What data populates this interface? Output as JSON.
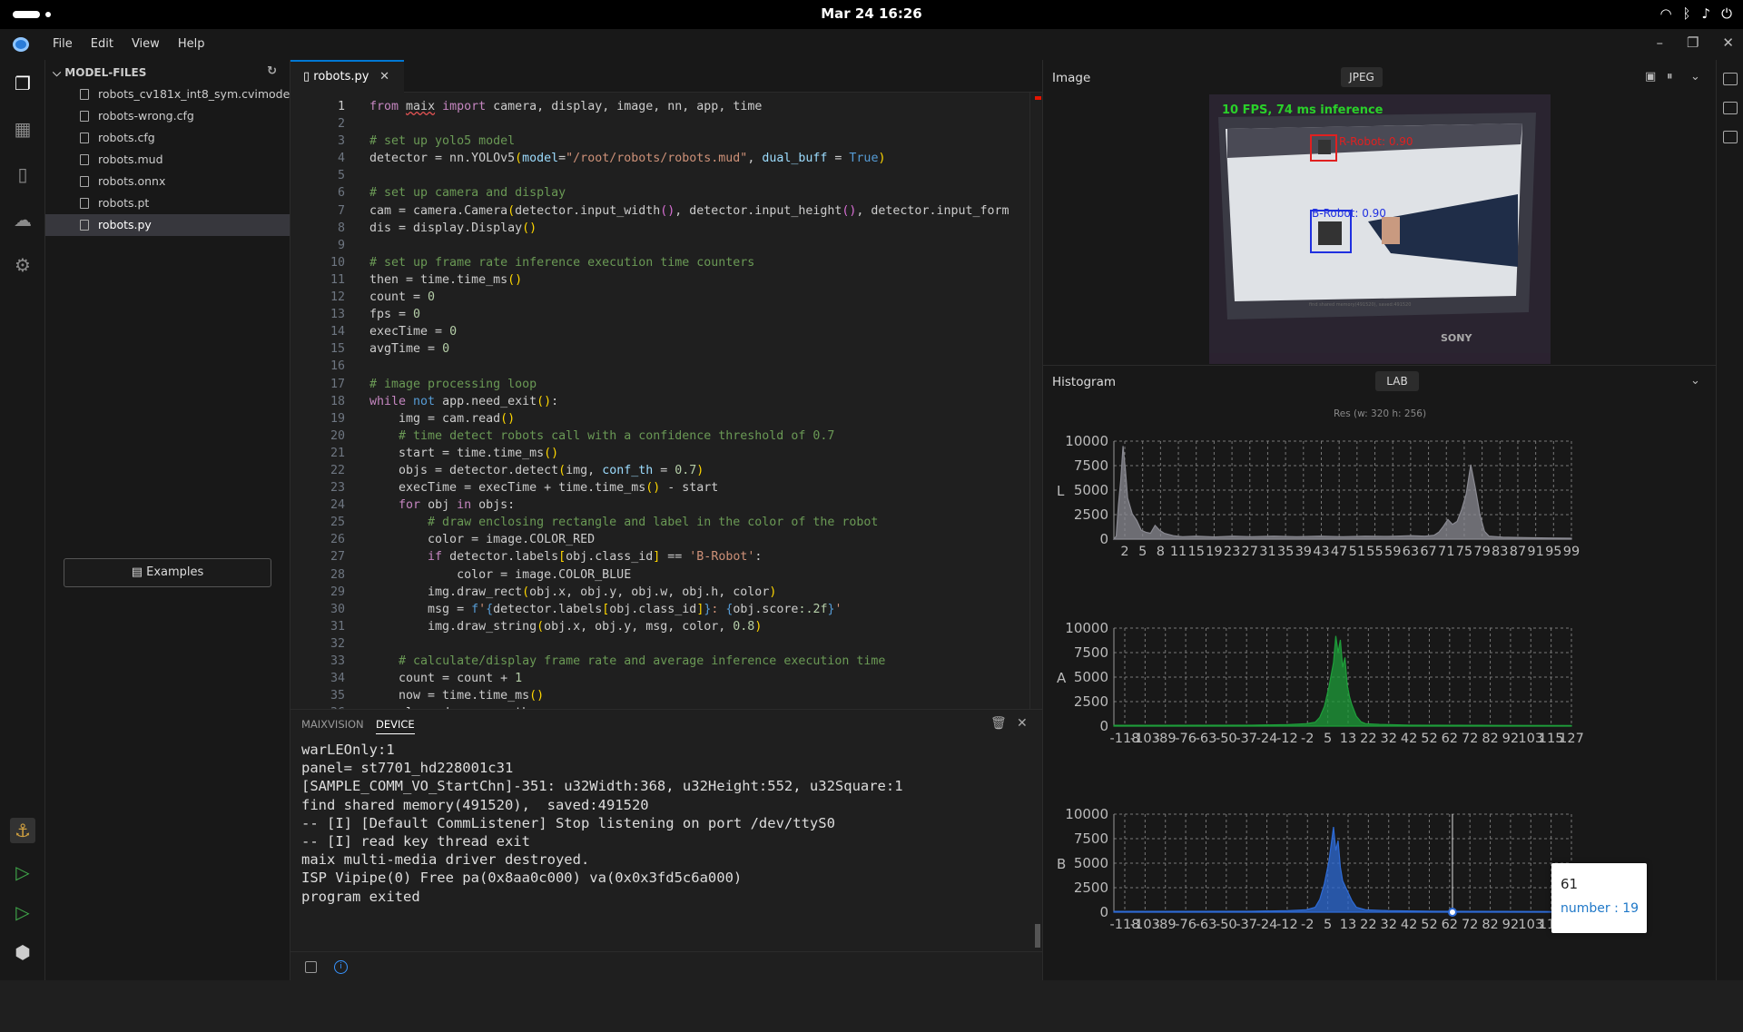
{
  "system": {
    "datetime": "Mar 24  16:26"
  },
  "menu": {
    "items": [
      "File",
      "Edit",
      "View",
      "Help"
    ]
  },
  "explorer": {
    "title": "MODEL-FILES",
    "files": [
      "robots_cv181x_int8_sym.cvimodel",
      "robots-wrong.cfg",
      "robots.cfg",
      "robots.mud",
      "robots.onnx",
      "robots.pt",
      "robots.py"
    ],
    "selected": "robots.py",
    "examples_label": "Examples"
  },
  "editor": {
    "tab_label": "robots.py",
    "current_line": 1
  },
  "terminal": {
    "tabs": [
      "MAIXVISION",
      "DEVICE"
    ],
    "active_tab": "DEVICE",
    "lines": [
      "warLEOnly:1",
      "panel= st7701_hd228001c31",
      "[SAMPLE_COMM_VO_StartChn]-351: u32Width:368, u32Height:552, u32Square:1",
      "find shared memory(491520),  saved:491520",
      "-- [I] [Default CommListener] Stop listening on port /dev/ttyS0",
      "-- [I] read key thread exit",
      "maix multi-media driver destroyed.",
      "ISP Vipipe(0) Free pa(0x8aa0c000) va(0x0x3fd5c6a000)",
      "",
      "program exited"
    ]
  },
  "image_panel": {
    "title": "Image",
    "format": "JPEG",
    "overlay": {
      "fps_text": "10 FPS, 74 ms inference",
      "label_red": "R-Robot: 0.90",
      "label_blue": "B-Robot: 0.90",
      "bottom_text": "find shared memory(491520), saved:491520",
      "brand": "SONY"
    }
  },
  "histogram_panel": {
    "title": "Histogram",
    "colorspace": "LAB",
    "resolution": "Res (w: 320 h: 256)"
  },
  "chart_data": [
    {
      "type": "area",
      "name": "L",
      "ylim": [
        0,
        10000
      ],
      "yticks": [
        0,
        2500,
        5000,
        7500,
        10000
      ],
      "xticks": [
        "2",
        "5",
        "8",
        "11",
        "15",
        "19",
        "23",
        "27",
        "31",
        "35",
        "39",
        "43",
        "47",
        "51",
        "55",
        "59",
        "63",
        "67",
        "71",
        "75",
        "79",
        "83",
        "87",
        "91",
        "95",
        "99"
      ],
      "xlim": [
        0,
        100
      ],
      "color": "#8a8a92",
      "points": [
        [
          0,
          0
        ],
        [
          0.5,
          300
        ],
        [
          1,
          3500
        ],
        [
          1.5,
          6000
        ],
        [
          2,
          9500
        ],
        [
          2.5,
          7200
        ],
        [
          3,
          4200
        ],
        [
          4,
          2600
        ],
        [
          5,
          1900
        ],
        [
          6,
          900
        ],
        [
          7,
          700
        ],
        [
          8,
          600
        ],
        [
          9,
          1400
        ],
        [
          10,
          900
        ],
        [
          11,
          600
        ],
        [
          13,
          350
        ],
        [
          15,
          250
        ],
        [
          18,
          300
        ],
        [
          22,
          220
        ],
        [
          26,
          300
        ],
        [
          30,
          250
        ],
        [
          35,
          300
        ],
        [
          40,
          250
        ],
        [
          45,
          300
        ],
        [
          50,
          250
        ],
        [
          55,
          300
        ],
        [
          60,
          280
        ],
        [
          65,
          350
        ],
        [
          68,
          300
        ],
        [
          70,
          400
        ],
        [
          71,
          700
        ],
        [
          72,
          1300
        ],
        [
          73,
          2000
        ],
        [
          74,
          1500
        ],
        [
          75,
          1800
        ],
        [
          76,
          3000
        ],
        [
          77,
          4600
        ],
        [
          78,
          7600
        ],
        [
          79,
          5200
        ],
        [
          80,
          2500
        ],
        [
          81,
          800
        ],
        [
          82,
          300
        ],
        [
          85,
          200
        ],
        [
          90,
          150
        ],
        [
          95,
          120
        ],
        [
          100,
          100
        ]
      ]
    },
    {
      "type": "area",
      "name": "A",
      "ylim": [
        0,
        10000
      ],
      "yticks": [
        0,
        2500,
        5000,
        7500,
        10000
      ],
      "xticks": [
        "-118",
        "-103",
        "-89",
        "-76",
        "-63",
        "-50",
        "-37",
        "-24",
        "-12",
        "-2",
        "5",
        "13",
        "22",
        "32",
        "42",
        "52",
        "62",
        "72",
        "82",
        "92",
        "103",
        "115",
        "127"
      ],
      "xlim": [
        0,
        100
      ],
      "color": "#1e9e3a",
      "points": [
        [
          0,
          80
        ],
        [
          30,
          100
        ],
        [
          38,
          150
        ],
        [
          42,
          250
        ],
        [
          44,
          400
        ],
        [
          45,
          900
        ],
        [
          46,
          2000
        ],
        [
          47,
          4000
        ],
        [
          48,
          6500
        ],
        [
          48.5,
          9200
        ],
        [
          49,
          7500
        ],
        [
          49.5,
          8800
        ],
        [
          50,
          6000
        ],
        [
          50.5,
          7000
        ],
        [
          51,
          4200
        ],
        [
          51.5,
          3000
        ],
        [
          52,
          2200
        ],
        [
          53,
          1000
        ],
        [
          54,
          450
        ],
        [
          55,
          250
        ],
        [
          58,
          180
        ],
        [
          65,
          100
        ],
        [
          80,
          80
        ],
        [
          100,
          60
        ]
      ]
    },
    {
      "type": "area",
      "name": "B",
      "ylim": [
        0,
        10000
      ],
      "yticks": [
        0,
        2500,
        5000,
        7500,
        10000
      ],
      "xticks": [
        "-118",
        "-103",
        "-89",
        "-76",
        "-63",
        "-50",
        "-37",
        "-24",
        "-12",
        "-2",
        "5",
        "13",
        "22",
        "32",
        "42",
        "52",
        "62",
        "72",
        "82",
        "92",
        "103",
        "115",
        "127"
      ],
      "xlim": [
        0,
        100
      ],
      "color": "#2e6bd6",
      "points": [
        [
          0,
          80
        ],
        [
          30,
          100
        ],
        [
          38,
          150
        ],
        [
          42,
          250
        ],
        [
          44,
          500
        ],
        [
          45,
          1300
        ],
        [
          46,
          2900
        ],
        [
          47,
          5200
        ],
        [
          48,
          8700
        ],
        [
          48.5,
          6300
        ],
        [
          49,
          7300
        ],
        [
          49.5,
          4600
        ],
        [
          50,
          3200
        ],
        [
          51,
          2200
        ],
        [
          52,
          1200
        ],
        [
          53,
          500
        ],
        [
          55,
          250
        ],
        [
          60,
          150
        ],
        [
          70,
          100
        ],
        [
          85,
          80
        ],
        [
          100,
          60
        ]
      ],
      "tooltip": {
        "value": "61",
        "count_label": "number : 19",
        "x": 74
      }
    }
  ]
}
